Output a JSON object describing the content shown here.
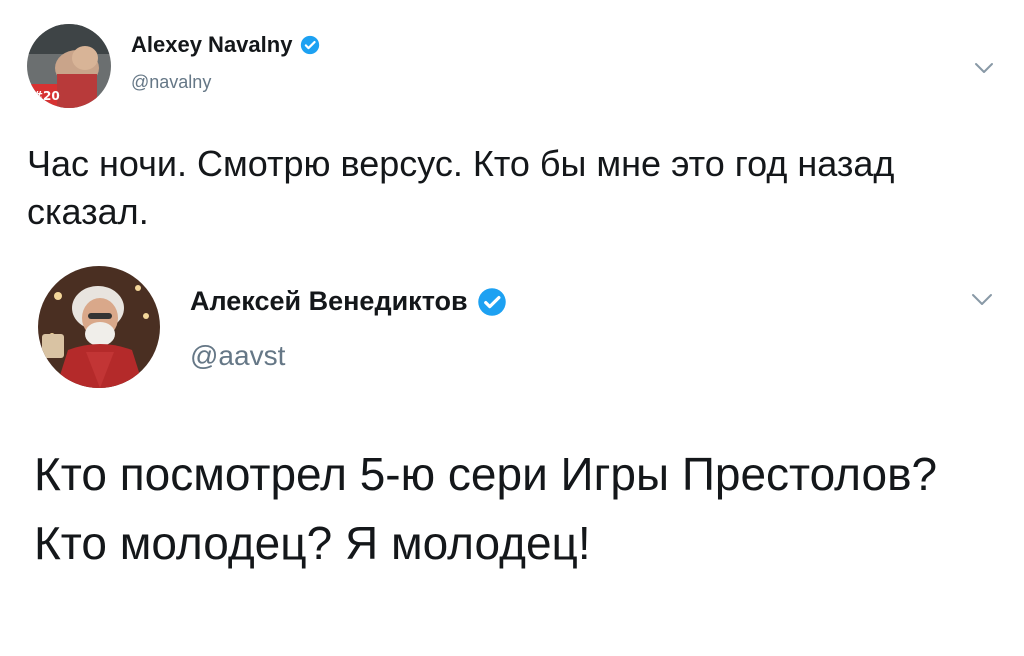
{
  "tweets": [
    {
      "display_name": "Alexey Navalny",
      "handle": "@navalny",
      "verified": true,
      "verified_icon": "verified-badge-icon",
      "menu_icon": "chevron-down-icon",
      "avatar_badge": "#20",
      "text": "Час ночи. Смотрю версус. Кто бы мне это год назад сказал."
    },
    {
      "display_name": "Алексей Венедиктов",
      "handle": "@aavst",
      "verified": true,
      "verified_icon": "verified-badge-icon",
      "menu_icon": "chevron-down-icon",
      "text": "Кто посмотрел 5-ю сери Игры Престолов? Кто молодец? Я молодец!"
    }
  ],
  "colors": {
    "text_primary": "#14171a",
    "text_secondary": "#657786",
    "verified_blue": "#1da1f2",
    "caret_gray": "#8899a6"
  }
}
